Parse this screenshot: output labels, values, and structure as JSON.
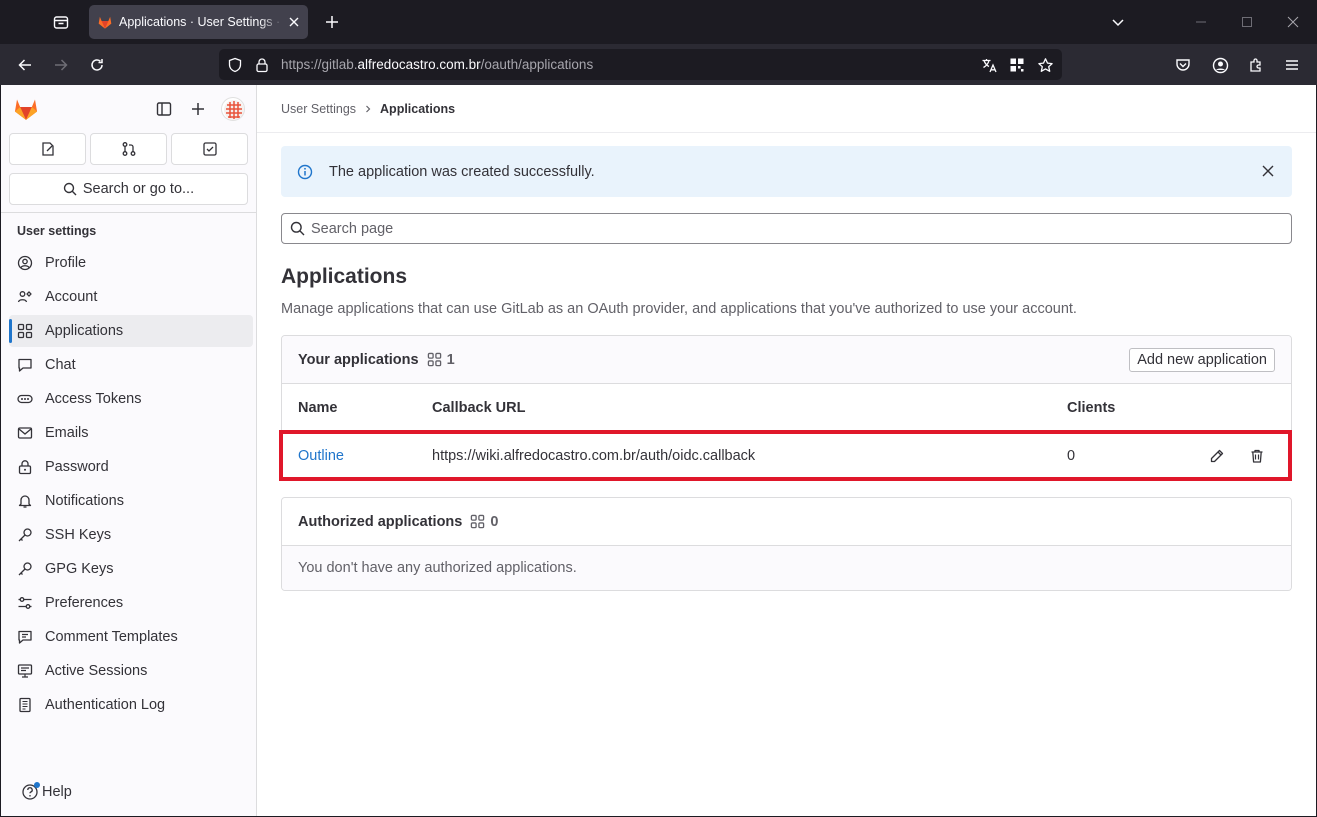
{
  "browser": {
    "tab_title": "Applications · User Settings · GitLab",
    "url_prefix": "https://gitlab.",
    "url_domain": "alfredocastro.com.br",
    "url_path": "/oauth/applications"
  },
  "sidebar": {
    "search_label": "Search or go to...",
    "heading": "User settings",
    "items": [
      {
        "label": "Profile",
        "icon": "profile-icon"
      },
      {
        "label": "Account",
        "icon": "account-icon"
      },
      {
        "label": "Applications",
        "icon": "applications-icon",
        "active": true
      },
      {
        "label": "Chat",
        "icon": "chat-icon"
      },
      {
        "label": "Access Tokens",
        "icon": "token-icon"
      },
      {
        "label": "Emails",
        "icon": "mail-icon"
      },
      {
        "label": "Password",
        "icon": "lock-icon"
      },
      {
        "label": "Notifications",
        "icon": "bell-icon"
      },
      {
        "label": "SSH Keys",
        "icon": "key-icon"
      },
      {
        "label": "GPG Keys",
        "icon": "key-icon"
      },
      {
        "label": "Preferences",
        "icon": "sliders-icon"
      },
      {
        "label": "Comment Templates",
        "icon": "comment-icon"
      },
      {
        "label": "Active Sessions",
        "icon": "monitor-icon"
      },
      {
        "label": "Authentication Log",
        "icon": "log-icon"
      }
    ],
    "help_label": "Help"
  },
  "breadcrumb": {
    "parent": "User Settings",
    "current": "Applications"
  },
  "alert": {
    "message": "The application was created successfully."
  },
  "search": {
    "placeholder": "Search page"
  },
  "page": {
    "title": "Applications",
    "description": "Manage applications that can use GitLab as an OAuth provider, and applications that you've authorized to use your account."
  },
  "your_apps": {
    "title": "Your applications",
    "count": "1",
    "add_button": "Add new application",
    "columns": [
      "Name",
      "Callback URL",
      "Clients"
    ],
    "rows": [
      {
        "name": "Outline",
        "callback_url": "https://wiki.alfredocastro.com.br/auth/oidc.callback",
        "clients": "0"
      }
    ]
  },
  "authorized_apps": {
    "title": "Authorized applications",
    "count": "0",
    "empty_message": "You don't have any authorized applications."
  },
  "colors": {
    "accent": "#1f75cb",
    "highlight": "#e0172a",
    "alert_bg": "#e9f3fc"
  }
}
